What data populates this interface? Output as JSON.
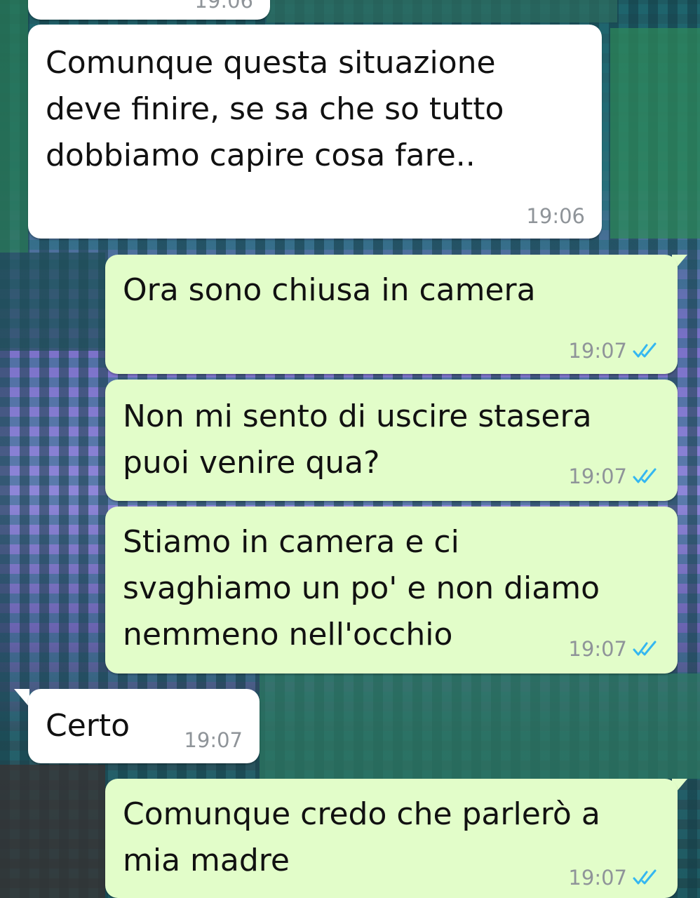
{
  "colors": {
    "incoming_bubble": "#ffffff",
    "outgoing_bubble": "#e2fdc9",
    "timestamp": "#8f9499",
    "read_ticks": "#34b7f1"
  },
  "top_partial_time": "19:06",
  "messages": [
    {
      "direction": "incoming",
      "text": "Comunque questa situazione\ndeve finire, se sa che so tutto\ndobbiamo capire cosa fare..",
      "time": "19:06"
    },
    {
      "direction": "outgoing",
      "text": "Ora sono chiusa in camera",
      "time": "19:07",
      "status_icon": "double-check-icon"
    },
    {
      "direction": "outgoing",
      "text": "Non mi sento di uscire stasera\npuoi venire qua?",
      "time": "19:07",
      "status_icon": "double-check-icon"
    },
    {
      "direction": "outgoing",
      "text": "Stiamo in camera e ci\nsvaghiamo un po' e non diamo\nnemmeno nell'occhio",
      "time": "19:07",
      "status_icon": "double-check-icon"
    },
    {
      "direction": "incoming",
      "text": "Certo",
      "time": "19:07"
    },
    {
      "direction": "outgoing",
      "text": "Comunque credo che parlerò a\nmia madre",
      "time": "19:07",
      "status_icon": "double-check-icon"
    }
  ]
}
